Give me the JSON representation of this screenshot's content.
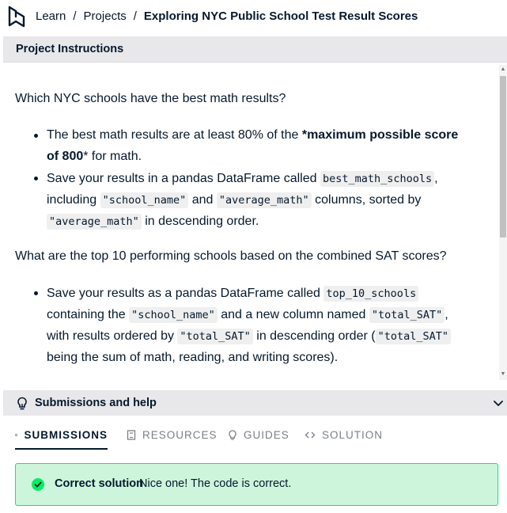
{
  "breadcrumb": {
    "learn": "Learn",
    "sep1": "/",
    "projects": "Projects",
    "sep2": "/",
    "current": "Exploring NYC Public School Test Result Scores"
  },
  "instructions": {
    "header": "Project Instructions",
    "q1": "Which NYC schools have the best math results?",
    "b1_l1_text": "The best math results are at least 80% of the ",
    "b1_l1_bold": "*maximum possible score",
    "b1_l2_bold": "of 800",
    "b1_l2_text": "* for math.",
    "b2_l1_text": "Save your results in a pandas DataFrame called ",
    "b2_l1_code": "best_math_schools",
    "b2_l1_after": ",",
    "b2_l2_text1": "including ",
    "b2_l2_code1": "\"school_name\"",
    "b2_l2_text2": " and ",
    "b2_l2_code2": "\"average_math\"",
    "b2_l2_text3": " columns, sorted by",
    "b2_l3_code": "\"average_math\"",
    "b2_l3_text": " in descending order.",
    "q2": "What are the top 10 performing schools based on the combined SAT scores?",
    "b3_l1_text": "Save your results as a pandas DataFrame called ",
    "b3_l1_code": "top_10_schools",
    "b3_l2_text1": "containing the ",
    "b3_l2_code1": "\"school_name\"",
    "b3_l2_text2": " and a new column named ",
    "b3_l2_code2": "\"total_SAT\"",
    "b3_l2_after": ",",
    "b3_l3_text1": "with results ordered by ",
    "b3_l3_code1": "\"total_SAT\"",
    "b3_l3_text2": " in descending order (",
    "b3_l3_code2": "\"total_SAT\"",
    "b3_l4_text": "being the sum of math, reading, and writing scores)."
  },
  "submissions": {
    "header": "Submissions and help",
    "tabs": [
      {
        "label": "SUBMISSIONS",
        "icon": "check-circle-icon",
        "active": true
      },
      {
        "label": "RESOURCES",
        "icon": "book-icon",
        "active": false
      },
      {
        "label": "GUIDES",
        "icon": "lightbulb-icon",
        "active": false
      },
      {
        "label": "SOLUTION",
        "icon": "code-icon",
        "active": false
      }
    ],
    "result_title": "Correct solution",
    "result_message": "Nice one! The code is correct."
  },
  "colors": {
    "navy": "#05192d",
    "panel_gray": "#e8e8ea",
    "success_bg": "#cdf5dc",
    "success_green": "#03ef62"
  }
}
